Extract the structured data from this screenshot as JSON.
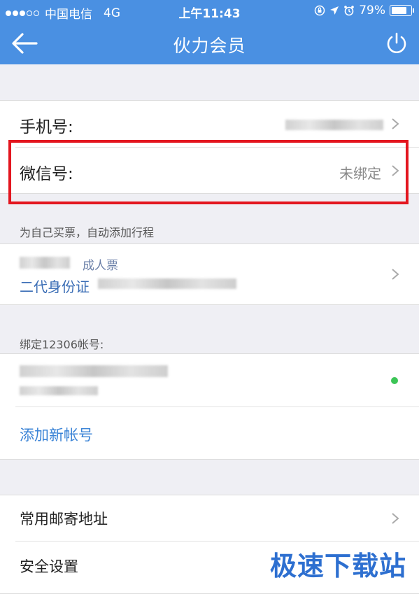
{
  "status_bar": {
    "carrier": "中国电信",
    "network": "4G",
    "time": "上午11:43",
    "battery": "79%",
    "battery_level": 0.79
  },
  "nav": {
    "title": "伙力会员",
    "back_icon": "back-arrow-icon",
    "power_icon": "power-icon"
  },
  "account": {
    "phone_label": "手机号:",
    "wechat_label": "微信号:",
    "wechat_value": "未绑定"
  },
  "passenger": {
    "caption": "为自己买票，自动添加行程",
    "ticket_type": "成人票",
    "id_type": "二代身份证"
  },
  "bind12306": {
    "caption": "绑定12306帐号:",
    "add_link": "添加新帐号"
  },
  "settings": {
    "address_label": "常用邮寄地址",
    "security_label": "安全设置"
  },
  "watermark": "极速下载站",
  "colors": {
    "nav_blue": "#4a90e2",
    "highlight_red": "#e3161f",
    "link_blue": "#3a83d6",
    "status_green": "#3cc556"
  }
}
